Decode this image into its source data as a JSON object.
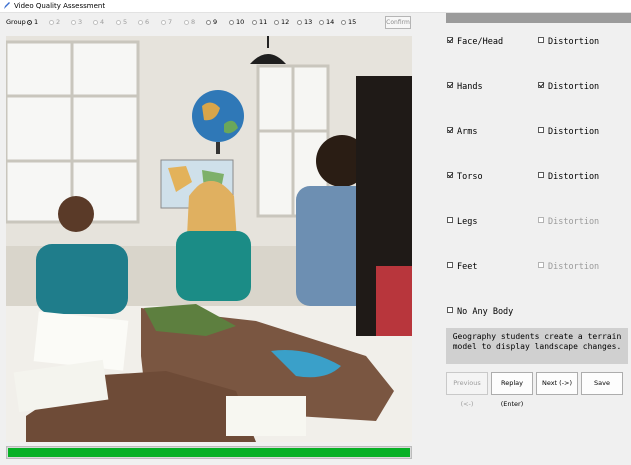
{
  "window": {
    "title": "Video Quality Assessment"
  },
  "groups": {
    "label": "Group",
    "items": [
      {
        "label": "1",
        "state": "selected"
      },
      {
        "label": "2",
        "state": "disabled"
      },
      {
        "label": "3",
        "state": "disabled"
      },
      {
        "label": "4",
        "state": "disabled"
      },
      {
        "label": "5",
        "state": "disabled"
      },
      {
        "label": "6",
        "state": "disabled"
      },
      {
        "label": "7",
        "state": "disabled"
      },
      {
        "label": "8",
        "state": "disabled"
      },
      {
        "label": "9",
        "state": "enabled"
      },
      {
        "label": "10",
        "state": "enabled"
      },
      {
        "label": "11",
        "state": "enabled"
      },
      {
        "label": "12",
        "state": "enabled"
      },
      {
        "label": "13",
        "state": "enabled"
      },
      {
        "label": "14",
        "state": "enabled"
      },
      {
        "label": "15",
        "state": "enabled"
      }
    ],
    "confirm_label": "Confirm"
  },
  "progress": {
    "value": 1.0,
    "color": "#06b025"
  },
  "body_parts": [
    {
      "label": "Face/Head",
      "checked": true,
      "distortion_label": "Distortion",
      "distortion_checked": false,
      "distortion_enabled": true
    },
    {
      "label": "Hands",
      "checked": true,
      "distortion_label": "Distortion",
      "distortion_checked": true,
      "distortion_enabled": true
    },
    {
      "label": "Arms",
      "checked": true,
      "distortion_label": "Distortion",
      "distortion_checked": false,
      "distortion_enabled": true
    },
    {
      "label": "Torso",
      "checked": true,
      "distortion_label": "Distortion",
      "distortion_checked": false,
      "distortion_enabled": true
    },
    {
      "label": "Legs",
      "checked": false,
      "distortion_label": "Distortion",
      "distortion_checked": false,
      "distortion_enabled": false
    },
    {
      "label": "Feet",
      "checked": false,
      "distortion_label": "Distortion",
      "distortion_checked": false,
      "distortion_enabled": false
    }
  ],
  "no_body": {
    "label": "No Any Body",
    "checked": false
  },
  "caption": "Geography students create a terrain model to display landscape changes.",
  "buttons": {
    "previous": "Previous (<-)",
    "replay": "Replay (Enter)",
    "next": "Next (->)",
    "save": "Save"
  }
}
